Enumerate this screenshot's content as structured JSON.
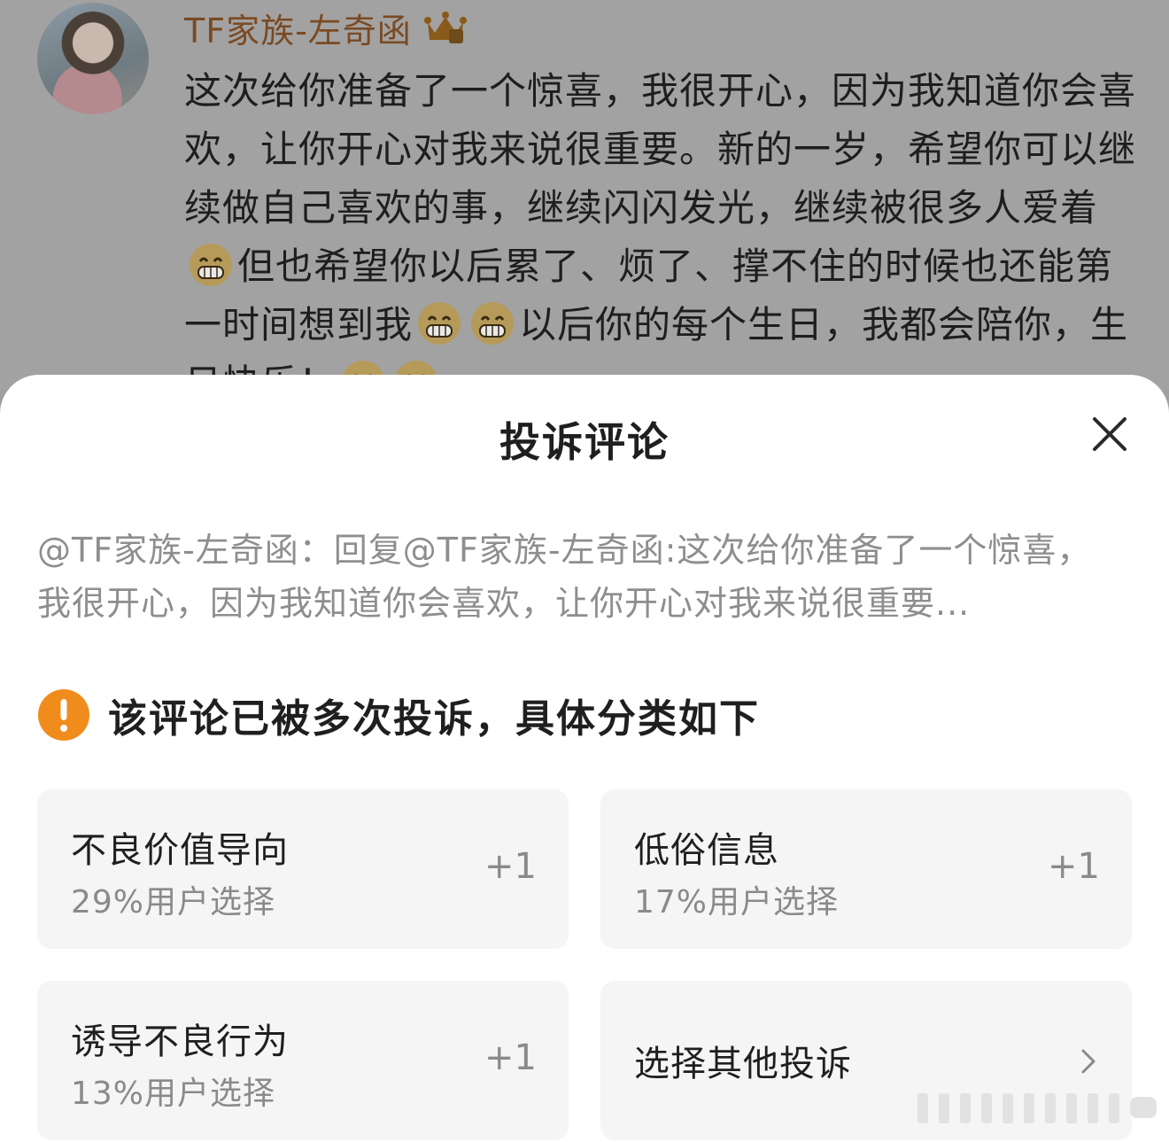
{
  "post": {
    "author": "TF家族-左奇函",
    "text_1": "这次给你准备了一个惊喜，我很开心，因为我知道你会喜欢，让你开心对我来说很重要。新的一岁，希望你可以继续做自己喜欢的事，继续闪闪发光，继续被很多人爱着",
    "text_2": "但也希望你以后累了、烦了、撑不住的时候也还能第一时间想到我",
    "text_3": "以后你的每个生日，我都会陪你，生日快乐！",
    "icons": [
      "avatar",
      "crown-badge-icon",
      "grin-emoji-icon"
    ]
  },
  "sheet": {
    "title": "投诉评论",
    "quoted_comment": "@TF家族-左奇函：回复@TF家族-左奇函:这次给你准备了一个惊喜，我很开心，因为我知道你会喜欢，让你开心对我来说很重要...",
    "warning": "该评论已被多次投诉，具体分类如下",
    "options": [
      {
        "title": "不良价值导向",
        "stat": "29%用户选择",
        "action": "+1"
      },
      {
        "title": "低俗信息",
        "stat": "17%用户选择",
        "action": "+1"
      },
      {
        "title": "诱导不良行为",
        "stat": "13%用户选择",
        "action": "+1"
      }
    ],
    "other": "选择其他投诉",
    "icons": [
      "close-icon",
      "warning-icon",
      "chevron-right-icon"
    ]
  },
  "colors": {
    "accent_orange": "#f08c1c",
    "author_brown": "#7a4a22",
    "card_bg": "#f5f5f5",
    "overlay_gray": "#a2a2a2"
  }
}
